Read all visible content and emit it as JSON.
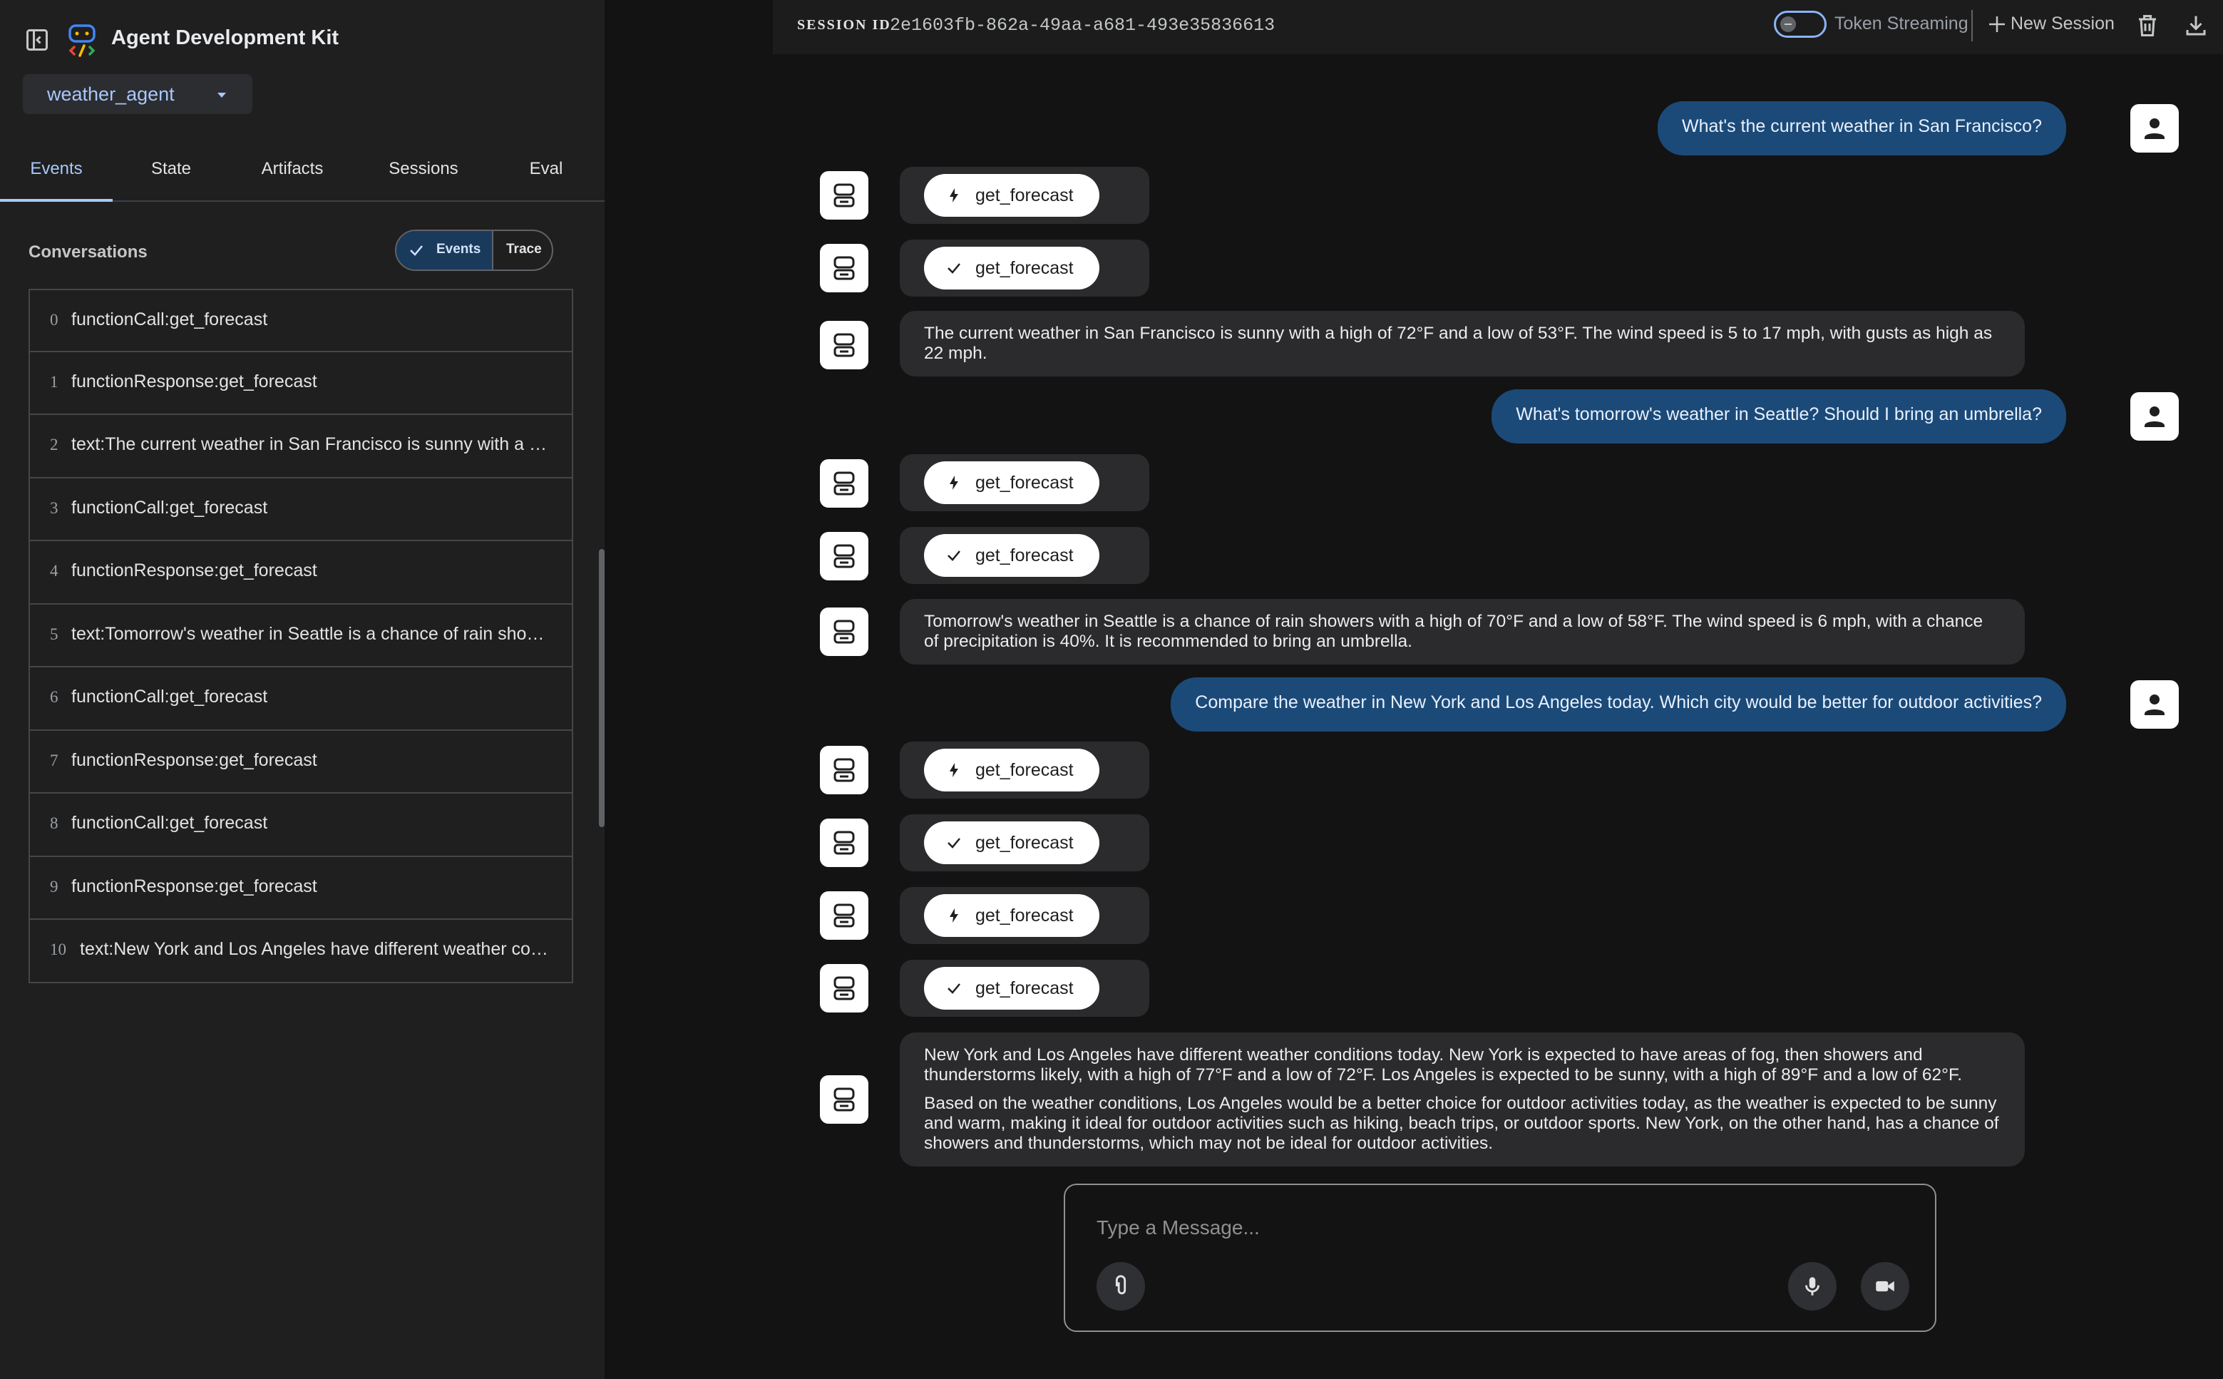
{
  "app": {
    "title": "Agent Development Kit",
    "agent": "weather_agent"
  },
  "sidebar": {
    "tabs": [
      {
        "label": "Events",
        "active": true
      },
      {
        "label": "State",
        "active": false
      },
      {
        "label": "Artifacts",
        "active": false
      },
      {
        "label": "Sessions",
        "active": false
      },
      {
        "label": "Eval",
        "active": false
      }
    ],
    "conversations_label": "Conversations",
    "view_toggle": {
      "events": "Events",
      "trace": "Trace",
      "selected": "Events"
    },
    "events": [
      {
        "index": "0",
        "text": "functionCall:get_forecast"
      },
      {
        "index": "1",
        "text": "functionResponse:get_forecast"
      },
      {
        "index": "2",
        "text": "text:The current weather in San Francisco is sunny with a high of 72°F and a low of 53°F. The wind speed is 5 to 17 mph, with gusts as high as 22 mph."
      },
      {
        "index": "3",
        "text": "functionCall:get_forecast"
      },
      {
        "index": "4",
        "text": "functionResponse:get_forecast"
      },
      {
        "index": "5",
        "text": "text:Tomorrow's weather in Seattle is a chance of rain showers with a high of 70°F and a low of 58°F."
      },
      {
        "index": "6",
        "text": "functionCall:get_forecast"
      },
      {
        "index": "7",
        "text": "functionResponse:get_forecast"
      },
      {
        "index": "8",
        "text": "functionCall:get_forecast"
      },
      {
        "index": "9",
        "text": "functionResponse:get_forecast"
      },
      {
        "index": "10",
        "text": "text:New York and Los Angeles have different weather conditions today."
      }
    ]
  },
  "topbar": {
    "session_label": "SESSION ID",
    "session_id": "2e1603fb-862a-49aa-a681-493e35836613",
    "token_streaming_label": "Token Streaming",
    "token_streaming_on": false,
    "new_session_label": "New Session"
  },
  "chat": {
    "user_messages": [
      "What's the current weather in San Francisco?",
      "What's tomorrow's weather in Seattle? Should I bring an umbrella?",
      "Compare the weather in New York and Los Angeles today. Which city would be better for outdoor activities?"
    ],
    "function_name": "get_forecast",
    "agent_texts": [
      "The current weather in San Francisco is sunny with a high of 72°F and a low of 53°F. The wind speed is 5 to 17 mph, with gusts as high as 22 mph.",
      "Tomorrow's weather in Seattle is a chance of rain showers with a high of 70°F and a low of 58°F. The wind speed is 6 mph, with a chance of precipitation is 40%. It is recommended to bring an umbrella.",
      "New York and Los Angeles have different weather conditions today. New York is expected to have areas of fog, then showers and thunderstorms likely, with a high of 77°F and a low of 72°F. Los Angeles is expected to be sunny, with a high of 89°F and a low of 62°F.",
      "Based on the weather conditions, Los Angeles would be a better choice for outdoor activities today, as the weather is expected to be sunny and warm, making it ideal for outdoor activities such as hiking, beach trips, or outdoor sports. New York, on the other hand, has a chance of showers and thunderstorms, which may not be ideal for outdoor activities."
    ]
  },
  "input": {
    "placeholder": "Type a Message..."
  },
  "colors": {
    "accent": "#a8c7fa",
    "user_bubble": "#1b4a78",
    "agent_bubble": "#2b2b2d"
  }
}
